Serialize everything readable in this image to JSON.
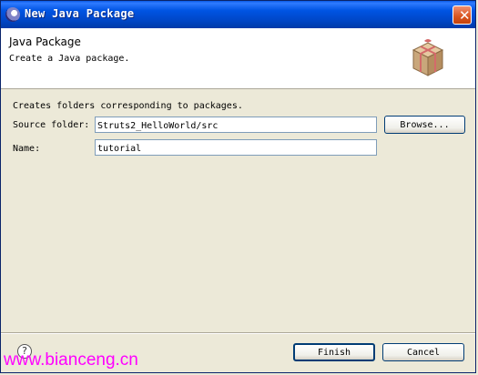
{
  "window": {
    "title": "New Java Package",
    "close_glyph": "✕"
  },
  "header": {
    "title": "Java Package",
    "description": "Create a Java package."
  },
  "form": {
    "description": "Creates folders corresponding to packages.",
    "source_folder_label": "Source folder:",
    "source_folder_value": "Struts2_HelloWorld/src",
    "browse_label": "Browse...",
    "name_label": "Name:",
    "name_value": "tutorial"
  },
  "footer": {
    "help_glyph": "?",
    "finish_label": "Finish",
    "cancel_label": "Cancel"
  },
  "watermark": "www.bianceng.cn",
  "colors": {
    "titlebar": "#0054e3",
    "dialog_bg": "#ece9d8",
    "watermark": "#ff00ff",
    "field_border": "#7f9db9"
  },
  "icons": [
    "eclipse-icon",
    "close-icon",
    "package-icon",
    "help-icon"
  ]
}
